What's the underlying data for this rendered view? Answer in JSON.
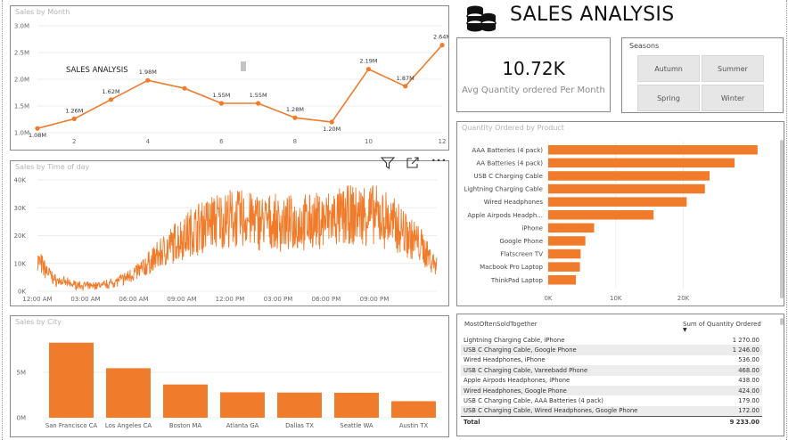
{
  "report_title": "SALES ANALYSIS",
  "sales_by_month": {
    "title": "Sales by Month",
    "overlay_text": "SALES ANALYSIS",
    "y_ticks": [
      "3.0M",
      "2.5M",
      "2.0M",
      "1.5M",
      "1.0M"
    ],
    "x_ticks": [
      "2",
      "4",
      "6",
      "8",
      "10",
      "12"
    ],
    "data_labels": [
      "1.08M",
      "1.26M",
      "1.62M",
      "1.98M",
      "1.55M",
      "1.55M",
      "1.28M",
      "1.20M",
      "2.19M",
      "1.87M",
      "2.64M"
    ]
  },
  "kpi": {
    "value": "10.72K",
    "label": "Avg Quantity ordered Per Month"
  },
  "seasons": {
    "label": "Seasons",
    "options": [
      "Autumn",
      "Summer",
      "Spring",
      "Winter"
    ]
  },
  "sales_by_time": {
    "title": "Sales by Time of day",
    "y_ticks": [
      "40K",
      "30K",
      "20K",
      "10K",
      "0K"
    ],
    "x_ticks": [
      "12:00 AM",
      "03:00 AM",
      "06:00 AM",
      "09:00 AM",
      "12:00 PM",
      "03:00 PM",
      "06:00 PM",
      "09:00 PM"
    ],
    "visual_header_icons": [
      "filter-icon",
      "focus-mode-icon",
      "more-options-icon"
    ],
    "more_options_glyph": "•••"
  },
  "quantity_by_product": {
    "title": "Quantity Ordered by Product",
    "x_ticks": [
      "0K",
      "10K",
      "20K"
    ]
  },
  "sales_by_city": {
    "title": "Sales by City",
    "y_ticks": [
      "5M",
      "0M"
    ]
  },
  "most_sold_together": {
    "headers": [
      "MostOftenSoldTogether",
      "Sum of Quantity Ordered"
    ],
    "rows": [
      [
        "Lightning Charging Cable, iPhone",
        "1 270.00"
      ],
      [
        "USB C Charging Cable, Google Phone",
        "1 246.00"
      ],
      [
        "Wired Headphones, iPhone",
        "536.00"
      ],
      [
        "USB C Charging Cable, Vareebadd Phone",
        "468.00"
      ],
      [
        "Apple Airpods Headphones, iPhone",
        "438.00"
      ],
      [
        "Wired Headphones, Google Phone",
        "424.00"
      ],
      [
        "USB C Charging Cable, AAA Batteries (4 pack)",
        "179.00"
      ],
      [
        "USB C Charging Cable, Wired Headphones, Google Phone",
        "172.00"
      ]
    ],
    "total_label": "Total",
    "total_value": "9 233.00"
  },
  "colors": {
    "accent": "#f07b2a",
    "panel_border": "#8a8a8a",
    "title_gray": "#b3b3b3"
  },
  "chart_data": [
    {
      "type": "line",
      "x": [
        1,
        2,
        3,
        4,
        5,
        6,
        7,
        8,
        9,
        10,
        11,
        12
      ],
      "series": [
        {
          "values": [
            1.08,
            1.26,
            1.62,
            1.98,
            1.83,
            1.55,
            1.55,
            1.28,
            1.2,
            2.19,
            1.87,
            2.64
          ]
        }
      ],
      "title": "Sales by Month",
      "ylim": [
        1.0,
        3.0
      ],
      "grid": true
    },
    {
      "type": "line",
      "x_range": [
        "12:00 AM",
        "11:59 PM"
      ],
      "series": [
        {
          "values": [
            11000,
            4000,
            2500,
            1800,
            2500,
            4500,
            8000,
            13000,
            18000,
            22000,
            25000,
            26000,
            26000,
            25000,
            24000,
            24500,
            25000,
            26000,
            27000,
            28000,
            26000,
            22000,
            17000,
            9000
          ]
        }
      ],
      "title": "Sales by Time of day",
      "ylim": [
        0,
        40000
      ],
      "grid": true
    },
    {
      "type": "bar",
      "orientation": "horizontal",
      "title": "Quantity Ordered by Product",
      "categories": [
        "AAA Batteries (4 pack)",
        "AA Batteries (4 pack)",
        "USB C Charging Cable",
        "Lightning Charging Cable",
        "Wired Headphones",
        "Apple Airpods Headph...",
        "iPhone",
        "Google Phone",
        "Flatscreen TV",
        "Macbook Pro Laptop",
        "ThinkPad Laptop"
      ],
      "values": [
        31000,
        27600,
        23900,
        23200,
        20500,
        15600,
        6800,
        5500,
        4800,
        4700,
        4100
      ],
      "xlim": [
        0,
        33000
      ]
    },
    {
      "type": "bar",
      "title": "Sales by City",
      "categories": [
        "San Francisco CA",
        "Los Angeles CA",
        "Boston MA",
        "Atlanta GA",
        "Dallas TX",
        "Seattle WA",
        "Austin TX"
      ],
      "values": [
        8.26,
        5.45,
        3.66,
        2.8,
        2.77,
        2.75,
        1.82
      ],
      "ylim": [
        0,
        10
      ]
    }
  ]
}
